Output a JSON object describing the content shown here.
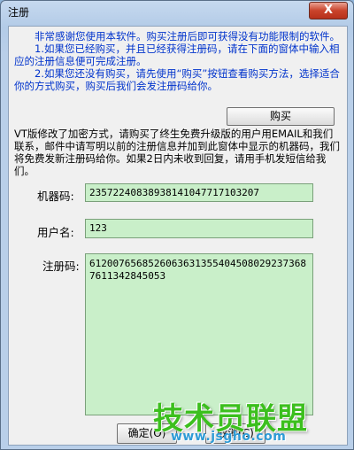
{
  "window": {
    "title": "注册",
    "close_glyph": "X"
  },
  "notice": {
    "line1": "非常感谢您使用本软件。购买注册后即可获得没有功能限制的软件。",
    "line2": "1.如果您已经购买，并且已经获得注册码，请在下面的窗体中输入相应的注册信息便可完成注册。",
    "line3": "2.如果您还没有购买，请先使用“购买”按钮查看购买方法，选择适合你的方式购买，购买后我们会发注册码给你。"
  },
  "buy_button": {
    "label": "购买"
  },
  "vt_notice": "VT版修改了加密方式，请购买了终生免费升级版的用户用EMAIL和我们联系，邮件中请写明以前的注册信息并加到此窗体中显示的机器码，我们将免费发新注册码给你。如果2日内未收到回复，请用手机发短信给我们。",
  "form": {
    "machine_code_label": "机器码:",
    "machine_code_value": "23572240838938141047717103207",
    "username_label": "用户名:",
    "username_value": "123",
    "regcode_label": "注册码:",
    "regcode_value": "61200765685260636313554045080292373687611342845053"
  },
  "buttons": {
    "ok_label": "确定(O)",
    "cancel_label": "取消(C)"
  },
  "watermark": {
    "brand": "技术员联盟",
    "url": "www.jsgho.com"
  },
  "colors": {
    "notice_text": "#0033cc",
    "field_bg": "#c9efc9"
  }
}
